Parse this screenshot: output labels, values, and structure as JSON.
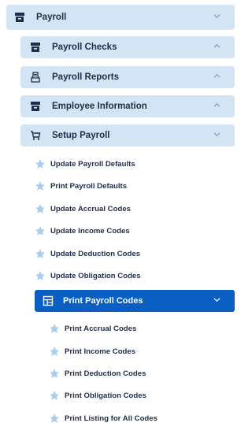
{
  "menu": {
    "root": {
      "label": "Payroll",
      "icon": "archive-box-icon",
      "expanded": true
    },
    "sections": [
      {
        "label": "Payroll Checks",
        "icon": "archive-box-icon",
        "expanded": false
      },
      {
        "label": "Payroll Reports",
        "icon": "inbox-tray-icon",
        "expanded": false
      },
      {
        "label": "Employee Information",
        "icon": "archive-box-icon",
        "expanded": false
      },
      {
        "label": "Setup Payroll",
        "icon": "shopping-cart-icon",
        "expanded": true
      }
    ],
    "setup_items": [
      {
        "label": "Update Payroll Defaults"
      },
      {
        "label": "Print Payroll Defaults"
      },
      {
        "label": "Update Accrual Codes"
      },
      {
        "label": "Update Income Codes"
      },
      {
        "label": "Update Deduction Codes"
      },
      {
        "label": "Update Obligation Codes"
      }
    ],
    "active_item": {
      "label": "Print Payroll Codes",
      "icon": "table-layout-icon",
      "expanded": true
    },
    "print_items": [
      {
        "label": "Print Accrual Codes"
      },
      {
        "label": "Print Income Codes"
      },
      {
        "label": "Print Deduction Codes"
      },
      {
        "label": "Print Obligation Codes"
      },
      {
        "label": "Print Listing for All Codes"
      }
    ]
  },
  "colors": {
    "header_bg": "#d3e4f5",
    "active_bg": "#0b5fc2",
    "text": "#1f2d4a",
    "star": "#a9cdee"
  }
}
